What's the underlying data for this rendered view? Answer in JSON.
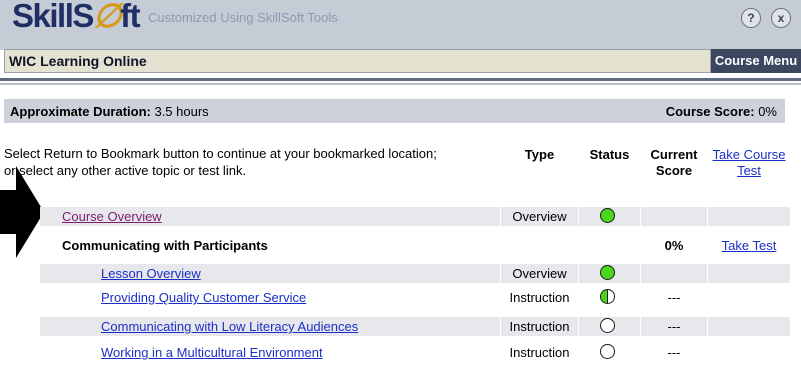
{
  "header": {
    "logo_text": "SkillSoft",
    "logo_a": "SkillS",
    "logo_b": "ft",
    "tagline": "Customized Using SkillSoft Tools",
    "help_glyph": "?",
    "close_glyph": "x"
  },
  "course": {
    "title": "WIC Learning Online",
    "menu_label": "Course Menu"
  },
  "summary": {
    "duration_label": "Approximate Duration:",
    "duration_value": "3.5 hours",
    "score_label": "Course Score:",
    "score_value": "0%"
  },
  "instructions": {
    "line1": "Select Return to Bookmark button to continue at your bookmarked location;",
    "line2": "or select any other active topic or test link."
  },
  "columns": {
    "type": "Type",
    "status": "Status",
    "current_1": "Current",
    "current_2": "Score",
    "take_course_1": "Take Course",
    "take_course_2": "Test"
  },
  "rows": [
    {
      "title": "Course Overview",
      "type": "Overview",
      "status": "complete",
      "score": "",
      "action": ""
    },
    {
      "title": "Communicating with Participants",
      "type": "",
      "status": "none",
      "score": "0%",
      "action": "Take Test"
    },
    {
      "title": "Lesson Overview",
      "type": "Overview",
      "status": "complete",
      "score": "",
      "action": ""
    },
    {
      "title": "Providing Quality Customer Service",
      "type": "Instruction",
      "status": "partial",
      "score": "---",
      "action": ""
    },
    {
      "title": "Communicating with Low Literacy Audiences",
      "type": "Instruction",
      "status": "not-started",
      "score": "---",
      "action": ""
    },
    {
      "title": "Working in a Multicultural Environment",
      "type": "Instruction",
      "status": "not-started",
      "score": "---",
      "action": ""
    }
  ],
  "colors": {
    "link_visited": "#7a1e6e",
    "link": "#1a2fc8",
    "status_complete": "#4bd61b",
    "menu_bg": "#3b465f"
  },
  "icons": {
    "pointer": "arrow-right-icon",
    "help": "help-icon",
    "close": "close-icon"
  }
}
